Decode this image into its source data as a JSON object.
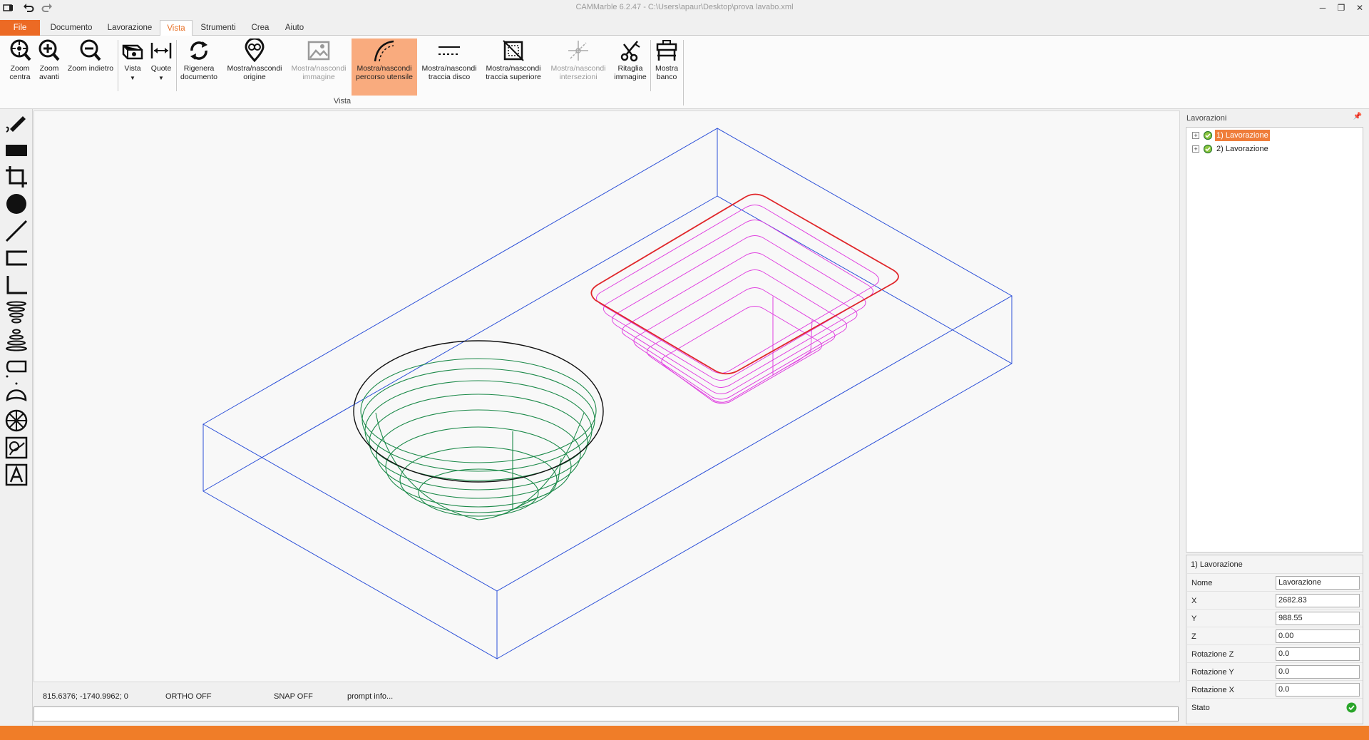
{
  "titlebar": {
    "title": "CAMMarble 6.2.47 - C:\\Users\\apaur\\Desktop\\prova lavabo.xml"
  },
  "menu": {
    "file": "File",
    "tabs": [
      "Documento",
      "Lavorazione",
      "Vista",
      "Strumenti",
      "Crea",
      "Aiuto"
    ],
    "active": "Vista"
  },
  "ribbon": {
    "group_label": "Vista",
    "buttons": [
      {
        "l1": "Zoom",
        "l2": "centra"
      },
      {
        "l1": "Zoom",
        "l2": "avanti"
      },
      {
        "l1": "Zoom indietro",
        "l2": ""
      },
      {
        "l1": "Vista",
        "l2": ""
      },
      {
        "l1": "Quote",
        "l2": ""
      },
      {
        "l1": "Rigenera",
        "l2": "documento"
      },
      {
        "l1": "Mostra/nascondi",
        "l2": "origine"
      },
      {
        "l1": "Mostra/nascondi",
        "l2": "immagine"
      },
      {
        "l1": "Mostra/nascondi",
        "l2": "percorso utensile"
      },
      {
        "l1": "Mostra/nascondi",
        "l2": "traccia disco"
      },
      {
        "l1": "Mostra/nascondi",
        "l2": "traccia superiore"
      },
      {
        "l1": "Mostra/nascondi",
        "l2": "intersezioni"
      },
      {
        "l1": "Ritaglia",
        "l2": "immagine"
      },
      {
        "l1": "Mostra",
        "l2": "banco"
      }
    ]
  },
  "status": {
    "coords": "815.6376; -1740.9962; 0",
    "ortho": "ORTHO OFF",
    "snap": "SNAP OFF",
    "prompt": "prompt info..."
  },
  "panel": {
    "header": "Lavorazioni",
    "tree": [
      "1) Lavorazione",
      "2) Lavorazione"
    ],
    "props_title": "1) Lavorazione",
    "props": [
      {
        "key": "Nome",
        "value": "Lavorazione"
      },
      {
        "key": "X",
        "value": "2682.83"
      },
      {
        "key": "Y",
        "value": "988.55"
      },
      {
        "key": "Z",
        "value": "0.00"
      },
      {
        "key": "Rotazione Z",
        "value": "0.0"
      },
      {
        "key": "Rotazione Y",
        "value": "0.0"
      },
      {
        "key": "Rotazione X",
        "value": "0.0"
      },
      {
        "key": "Stato",
        "value": ""
      }
    ]
  },
  "colors": {
    "accent": "#ec6a24",
    "stock_box": "#2b4fd8",
    "bowl_toolpath": "#1d8a4a",
    "sink_outline": "#e0262a",
    "sink_toolpath": "#e040e0"
  },
  "icons": [
    "undo-icon",
    "redo-icon",
    "zoom-center-icon",
    "zoom-in-icon",
    "zoom-out-icon",
    "view-icon",
    "dimensions-icon",
    "regenerate-icon",
    "origin-icon",
    "image-icon",
    "toolpath-icon",
    "disc-trace-icon",
    "top-trace-icon",
    "intersections-icon",
    "crop-icon",
    "bench-icon"
  ]
}
